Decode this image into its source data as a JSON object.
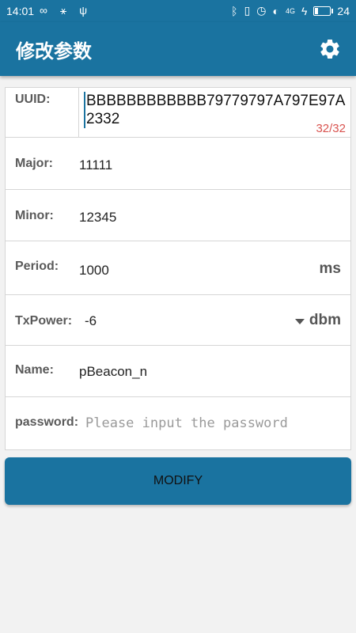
{
  "statusbar": {
    "time": "14:01",
    "battery_level": "24",
    "battery_fill": 0.24,
    "signal": "4G"
  },
  "appbar": {
    "title": "修改参数"
  },
  "form": {
    "uuid": {
      "label": "UUID:",
      "value": "BBBBBBBBBBBB79779797A797E97A2332",
      "counter": "32/32"
    },
    "major": {
      "label": "Major:",
      "value": "11111"
    },
    "minor": {
      "label": "Minor:",
      "value": "12345"
    },
    "period": {
      "label": "Period:",
      "value": "1000",
      "unit": "ms"
    },
    "txpower": {
      "label": "TxPower:",
      "value": "-6",
      "unit": "dbm"
    },
    "name": {
      "label": "Name:",
      "value": "pBeacon_n"
    },
    "password": {
      "label": "password:",
      "placeholder": "Please input the password"
    }
  },
  "button": {
    "modify": "MODIFY"
  },
  "colors": {
    "primary": "#1a73a0",
    "counter": "#d9534f"
  }
}
